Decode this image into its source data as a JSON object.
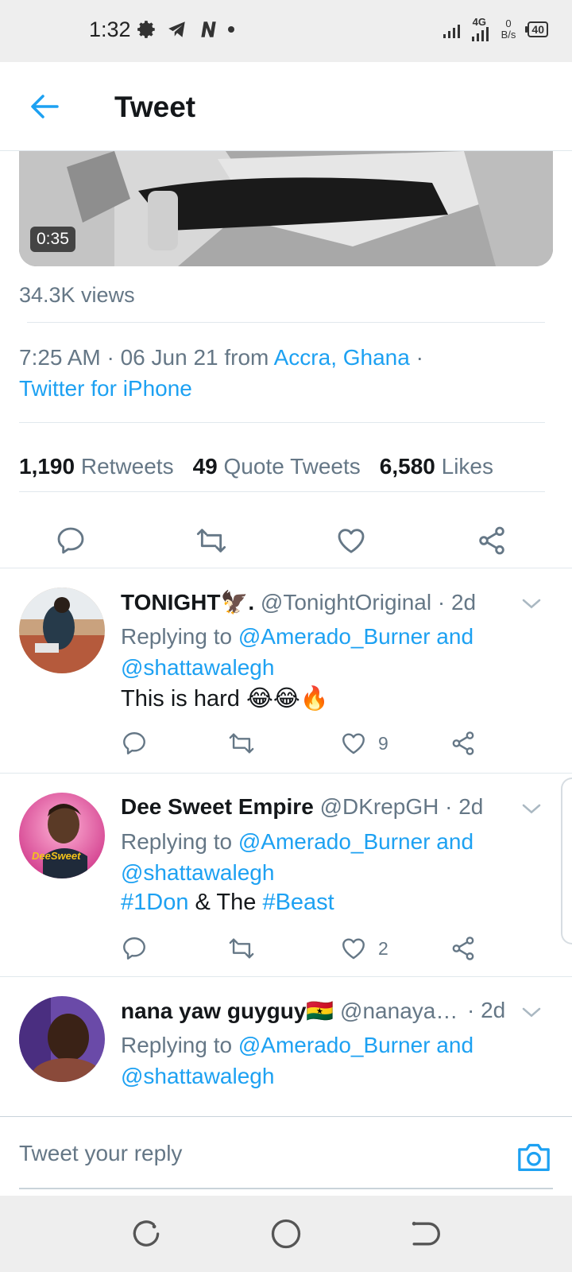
{
  "status_bar": {
    "time": "1:32",
    "network": "4G",
    "speed_value": "0",
    "speed_unit": "B/s",
    "battery": "40"
  },
  "header": {
    "title": "Tweet"
  },
  "media": {
    "duration": "0:35"
  },
  "tweet": {
    "views": "34.3K views",
    "time_date": "7:25 AM · 06 Jun 21 from ",
    "location": "Accra, Ghana",
    "sep": " ·",
    "source": "Twitter for iPhone",
    "retweets_count": "1,190",
    "retweets_label": "Retweets",
    "quotes_count": "49",
    "quotes_label": "Quote Tweets",
    "likes_count": "6,580",
    "likes_label": "Likes"
  },
  "replies": [
    {
      "name": "TONIGHT🦅.",
      "handle": "@TonightOriginal · 2d",
      "replying_prefix": "Replying to ",
      "replying_1": "@Amerado_Burner and",
      "replying_2": "@shattawalegh",
      "text": "This is hard 😂😂🔥",
      "likes": "9"
    },
    {
      "name": "Dee Sweet Empire",
      "handle": "@DKrepGH · 2d",
      "replying_prefix": "Replying to ",
      "replying_1": "@Amerado_Burner and",
      "replying_2": "@shattawalegh",
      "tag1": "#1Don",
      "text_mid": " & The ",
      "tag2": "#Beast",
      "likes": "2",
      "avatar_text": "DeeSweet"
    },
    {
      "name": "nana yaw guyguy🇬🇭",
      "handle": "@nanaya…",
      "time": "· 2d",
      "replying_prefix": "Replying to ",
      "replying_1": "@Amerado_Burner and",
      "replying_2": "@shattawalegh"
    }
  ],
  "reply_bar": {
    "placeholder": "Tweet your reply"
  },
  "colors": {
    "accent": "#1da1f2",
    "muted": "#657786",
    "text": "#14171a"
  }
}
